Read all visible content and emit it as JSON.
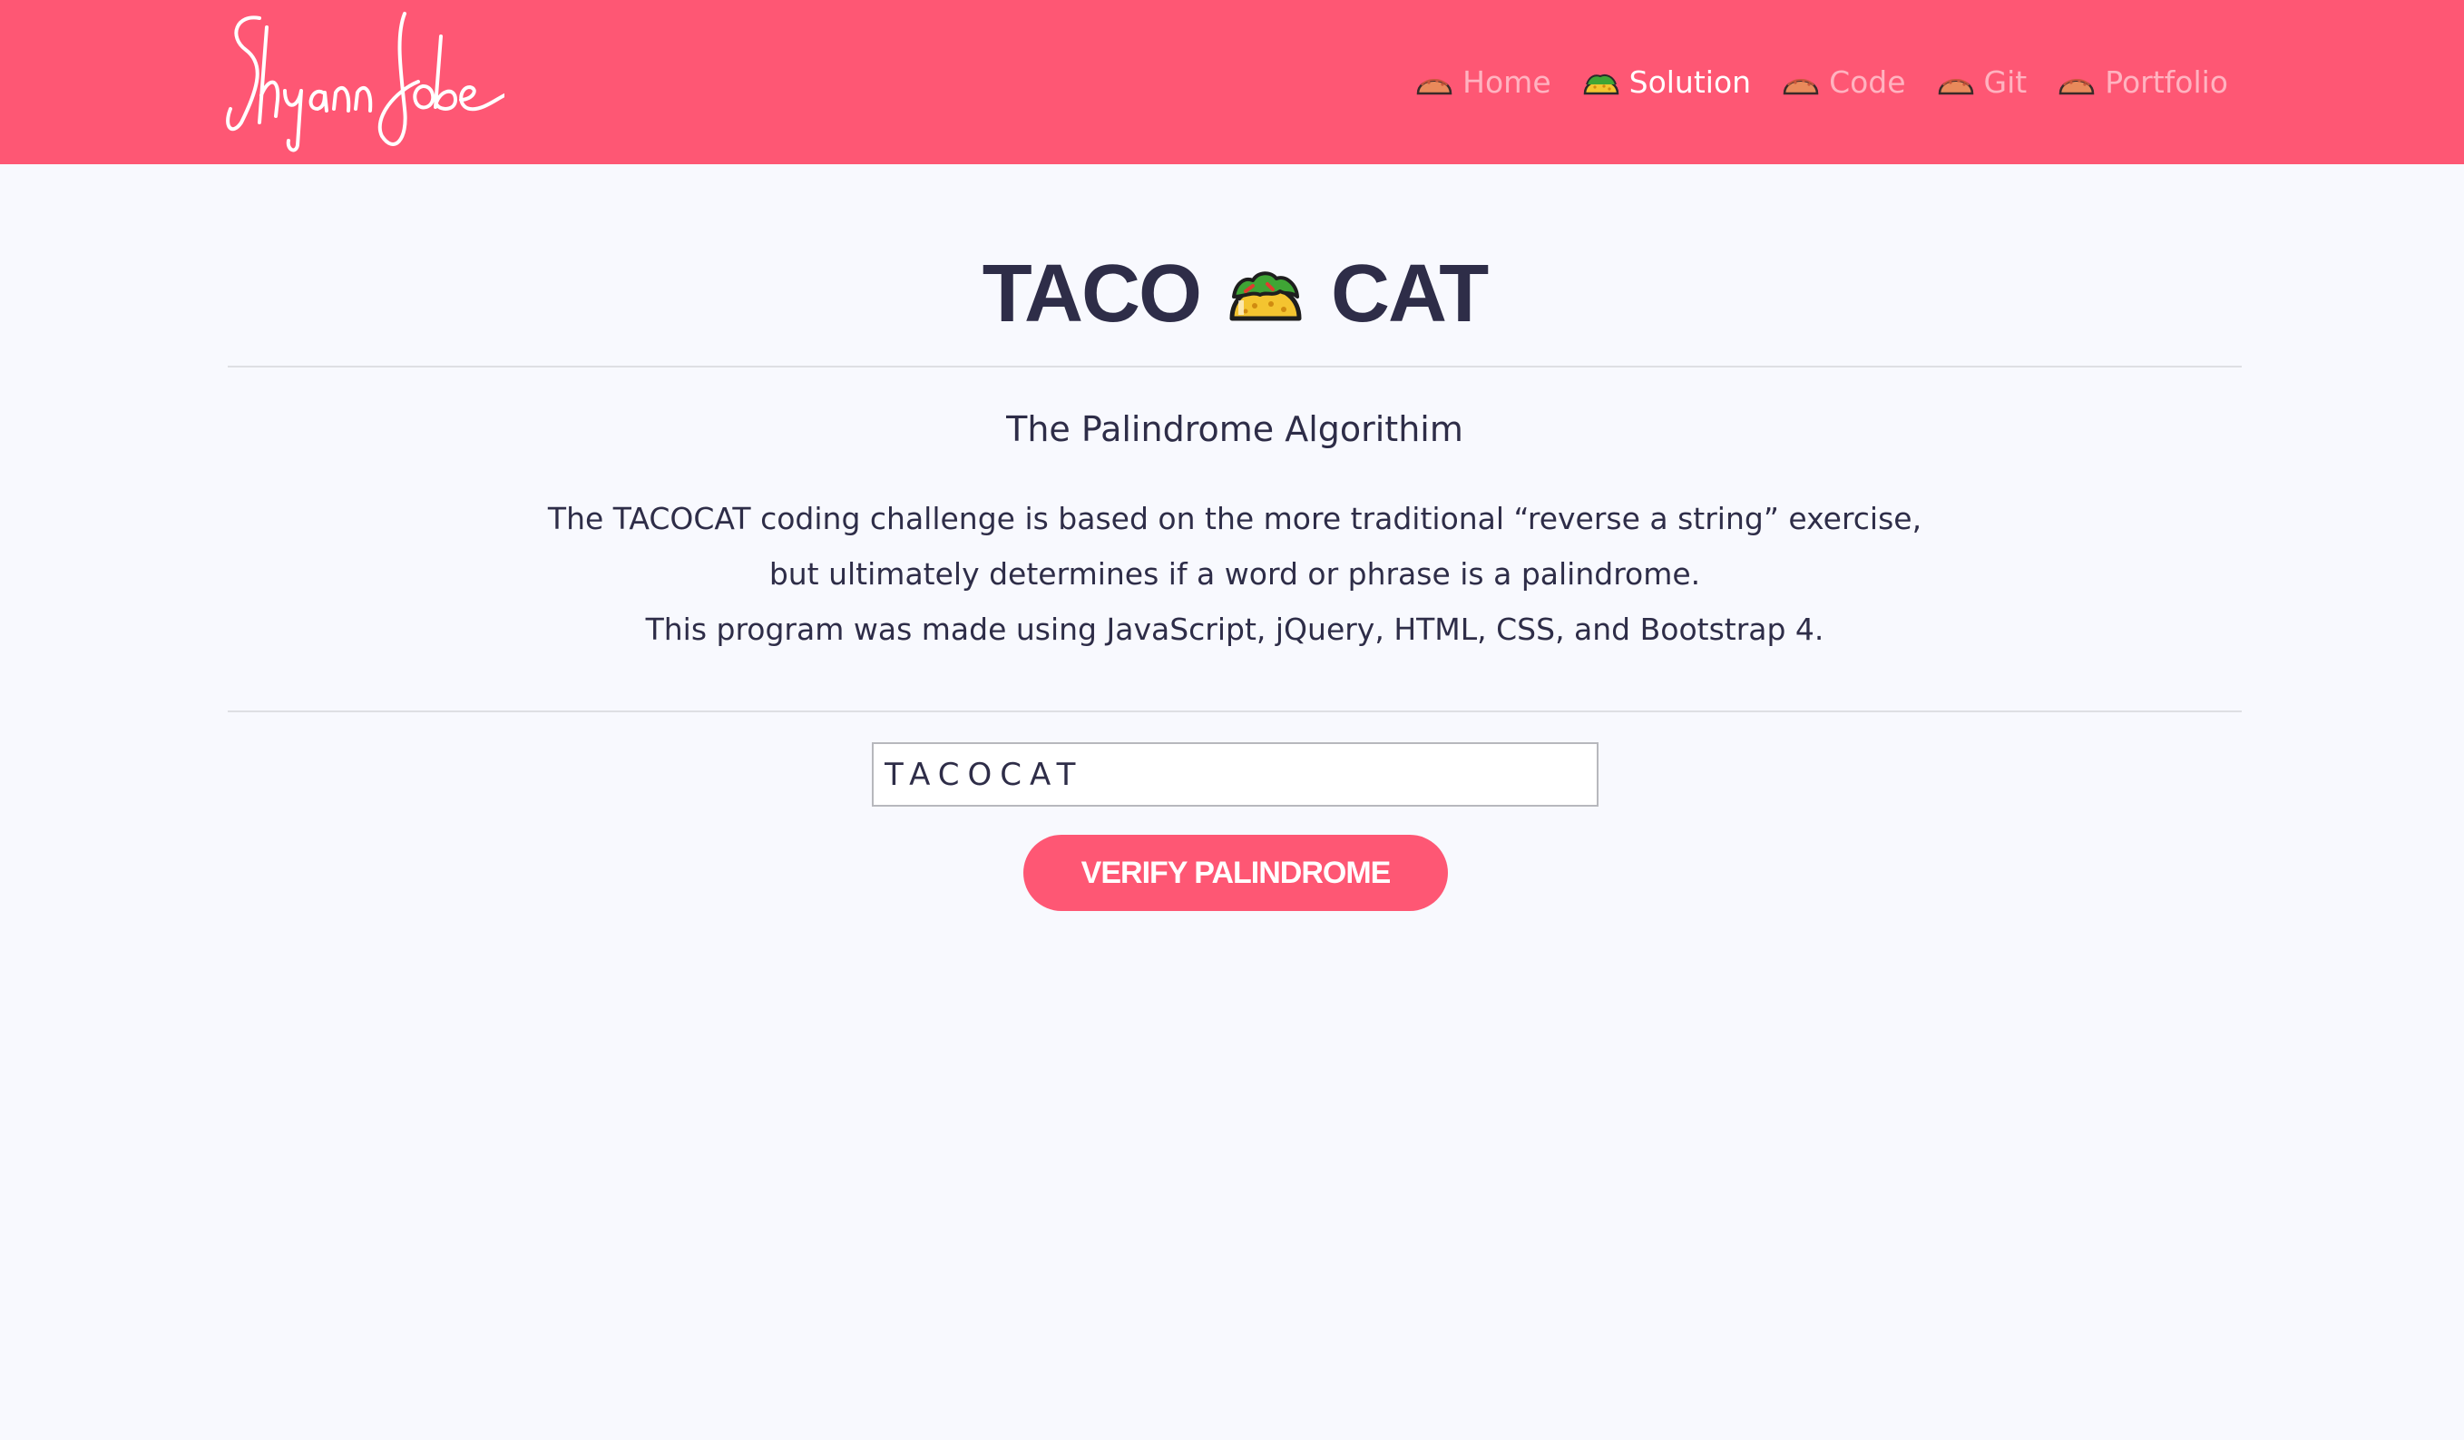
{
  "brand": {
    "logo_text": "Shyann Jobe"
  },
  "nav": {
    "items": [
      {
        "label": "Home",
        "icon": "taco-icon",
        "active": false
      },
      {
        "label": "Solution",
        "icon": "taco-icon",
        "active": true
      },
      {
        "label": "Code",
        "icon": "taco-icon",
        "active": false
      },
      {
        "label": "Git",
        "icon": "taco-icon",
        "active": false
      },
      {
        "label": "Portfolio",
        "icon": "taco-icon",
        "active": false
      }
    ]
  },
  "main": {
    "title_left": "TACO",
    "title_icon": "taco-icon",
    "title_right": "CAT",
    "subtitle": "The Palindrome Algorithim",
    "description": [
      "The TACOCAT coding challenge is based on the more traditional “reverse a string” exercise,",
      "but ultimately determines if a word or phrase is a palindrome.",
      "This program was made using JavaScript, jQuery, HTML, CSS, and Bootstrap 4."
    ],
    "input_value": "TACOCAT",
    "button_label": "VERIFY PALINDROME"
  },
  "colors": {
    "brand": "#fe5774",
    "text": "#2e2d48",
    "background": "#f8f9fe"
  }
}
